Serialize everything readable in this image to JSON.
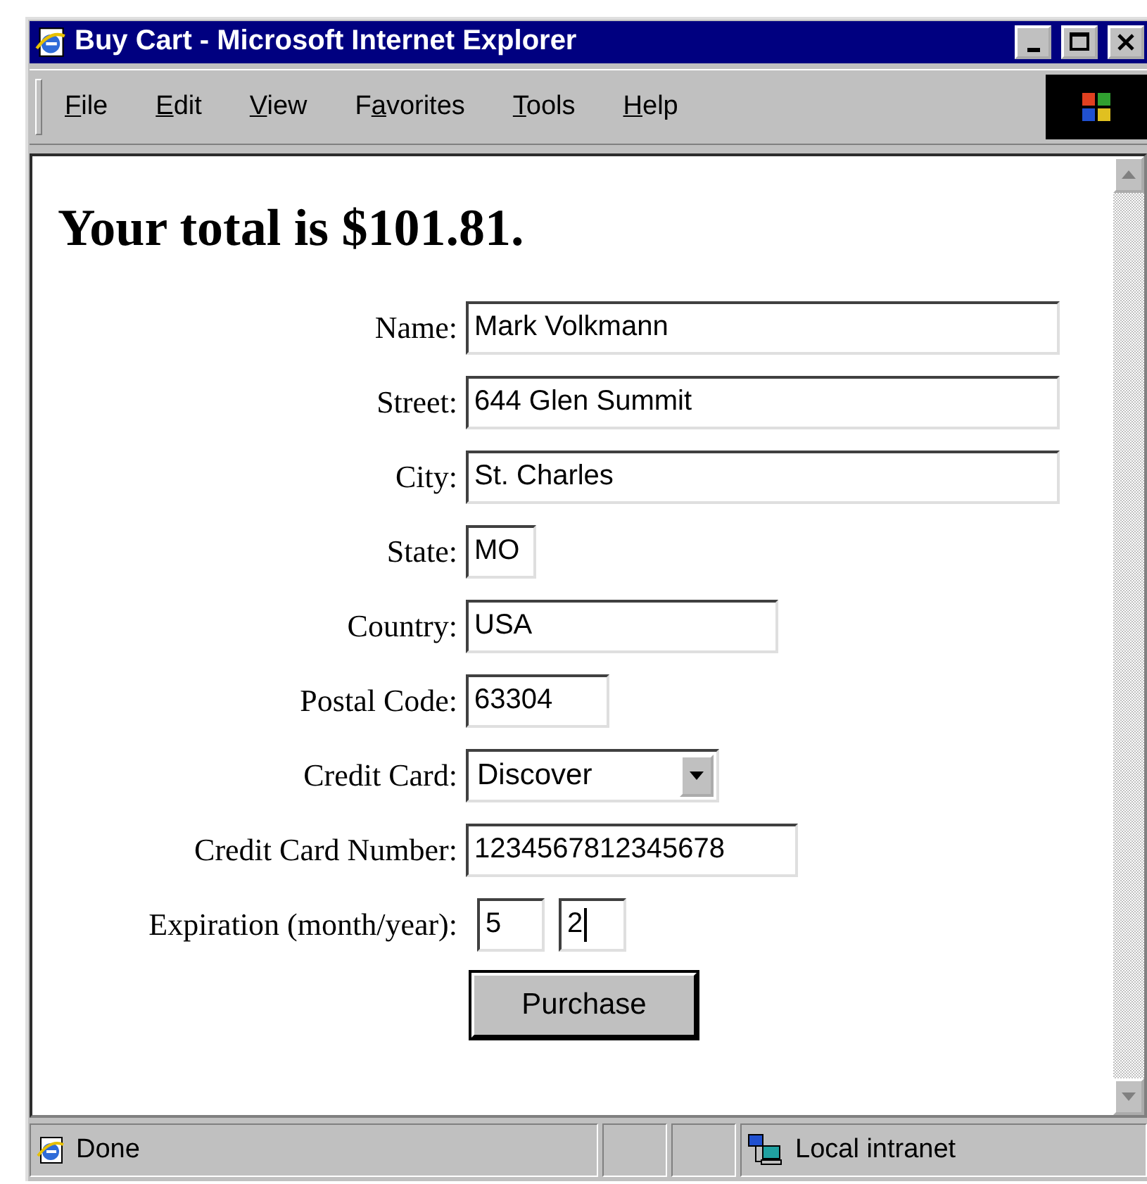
{
  "window": {
    "title": "Buy Cart - Microsoft Internet Explorer"
  },
  "menu": [
    {
      "key": "F",
      "after": "ile"
    },
    {
      "key": "E",
      "after": "dit"
    },
    {
      "key": "V",
      "after": "iew"
    },
    {
      "before": "F",
      "key": "a",
      "after": "vorites"
    },
    {
      "key": "T",
      "after": "ools"
    },
    {
      "key": "H",
      "after": "elp"
    }
  ],
  "page": {
    "heading": "Your total is $101.81.",
    "fields": [
      {
        "label": "Name:",
        "kind": "text",
        "value": "Mark Volkmann"
      },
      {
        "label": "Street:",
        "kind": "text",
        "value": "644 Glen Summit"
      },
      {
        "label": "City:",
        "kind": "text",
        "value": "St. Charles"
      },
      {
        "label": "State:",
        "kind": "text",
        "value": "MO"
      },
      {
        "label": "Country:",
        "kind": "text",
        "value": "USA"
      },
      {
        "label": "Postal Code:",
        "kind": "text",
        "value": "63304"
      },
      {
        "label": "Credit Card:",
        "kind": "select",
        "value": "Discover"
      },
      {
        "label": "Credit Card Number:",
        "kind": "text",
        "value": "1234567812345678"
      },
      {
        "label": "Expiration (month/year):",
        "kind": "pair",
        "inputs": [
          {
            "value": "5",
            "focused": false
          },
          {
            "value": "2",
            "focused": true
          }
        ]
      }
    ],
    "button": "Purchase"
  },
  "status_bar": {
    "text": "Done",
    "zone": "Local intranet"
  }
}
